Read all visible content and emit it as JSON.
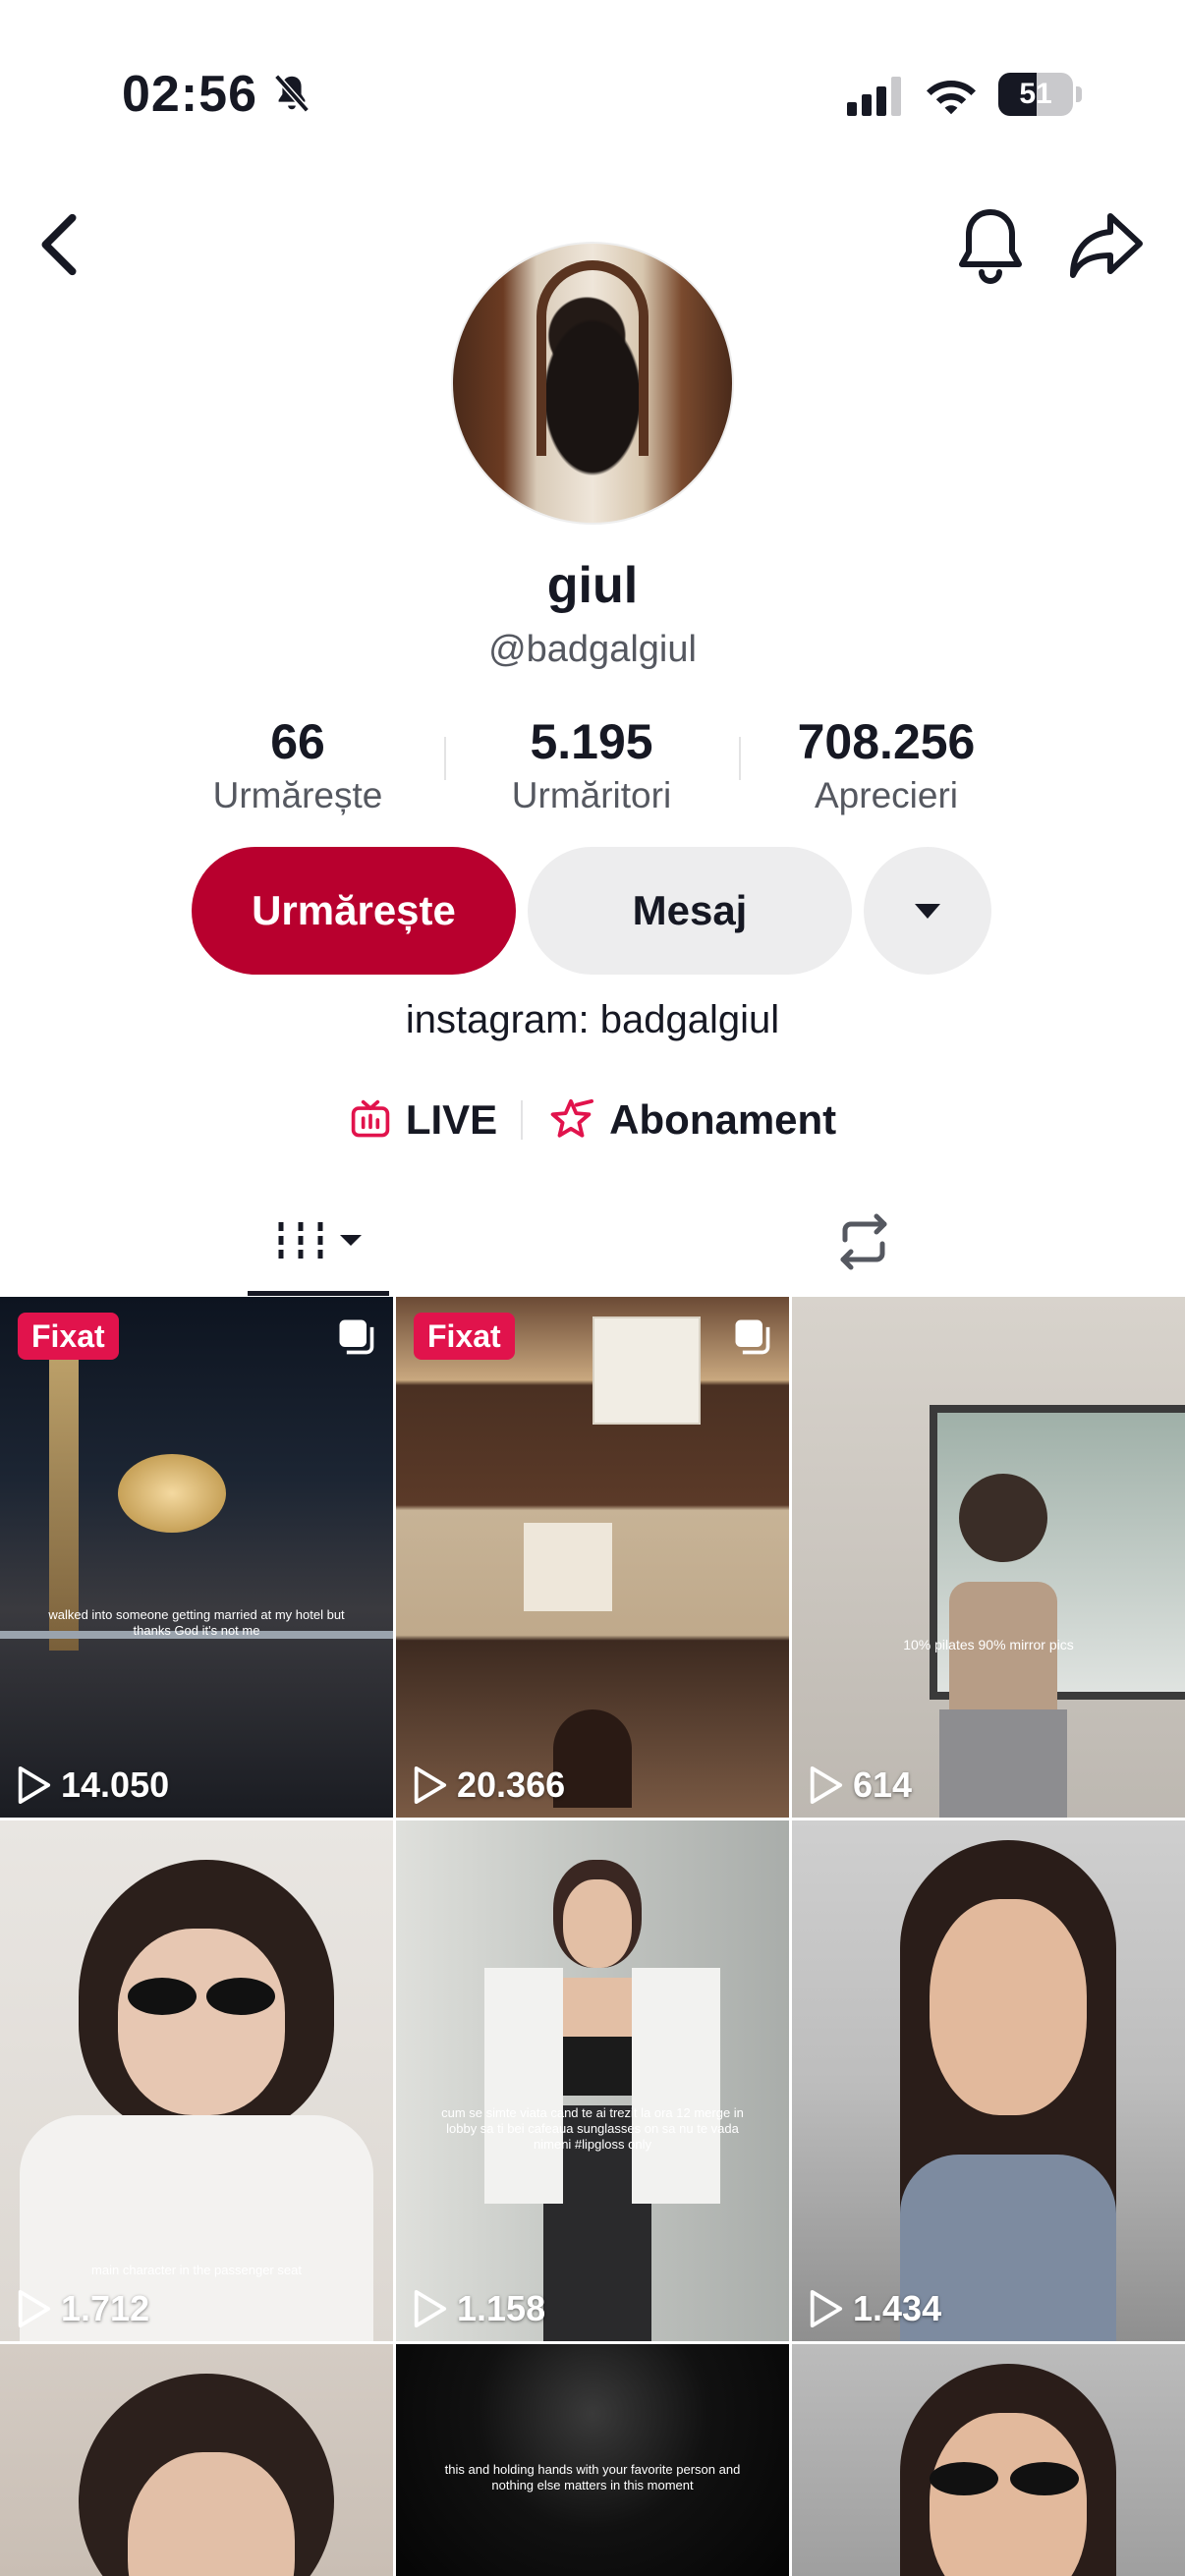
{
  "status_bar": {
    "time": "02:56",
    "battery": "51",
    "battery_level": 0.51,
    "icons": [
      "bell-muted-icon",
      "cellular-signal-icon",
      "wifi-icon",
      "battery-icon"
    ]
  },
  "nav": {
    "icons": [
      "chevron-left-icon",
      "bell-icon",
      "share-arrow-icon"
    ]
  },
  "profile": {
    "display_name": "giul",
    "username": "@badgalgiul",
    "stats": [
      {
        "value": "66",
        "label": "Urmărește"
      },
      {
        "value": "5.195",
        "label": "Urmăritori"
      },
      {
        "value": "708.256",
        "label": "Aprecieri"
      }
    ],
    "follow_label": "Urmărește",
    "message_label": "Mesaj",
    "bio": "instagram: badgalgiul",
    "links": [
      {
        "label": "LIVE",
        "icon": "live-tv-icon"
      },
      {
        "label": "Abonament",
        "icon": "subscription-star-icon"
      }
    ]
  },
  "tabs": {
    "icons": [
      "grid-videos-icon",
      "repost-icon"
    ],
    "active": "grid-videos"
  },
  "colors": {
    "accent": "#b8002e",
    "pinned_badge": "#e1134c",
    "text_primary": "#161823",
    "text_secondary": "#555860"
  },
  "videos": [
    {
      "views": "14.050",
      "pinned": "Fixat",
      "multi": true,
      "caption": "walked into someone getting married at my hotel but thanks God it's not me"
    },
    {
      "views": "20.366",
      "pinned": "Fixat",
      "multi": true,
      "caption": ""
    },
    {
      "views": "614",
      "pinned": "",
      "multi": false,
      "caption": "10% pilates 90% mirror pics"
    },
    {
      "views": "1.712",
      "pinned": "",
      "multi": false,
      "caption": "main character in the passenger seat"
    },
    {
      "views": "1.158",
      "pinned": "",
      "multi": false,
      "caption": "cum se simte viata cand te ai trezit la ora 12 merge in lobby sa ti bei cafeaua sunglasses on sa nu te vada nimeni #lipgloss only"
    },
    {
      "views": "1.434",
      "pinned": "",
      "multi": false,
      "caption": ""
    },
    {
      "views": "",
      "pinned": "",
      "multi": false,
      "caption": ""
    },
    {
      "views": "",
      "pinned": "",
      "multi": false,
      "caption": "this and holding hands with your favorite person and nothing else matters in this moment"
    },
    {
      "views": "",
      "pinned": "",
      "multi": false,
      "caption": ""
    }
  ]
}
